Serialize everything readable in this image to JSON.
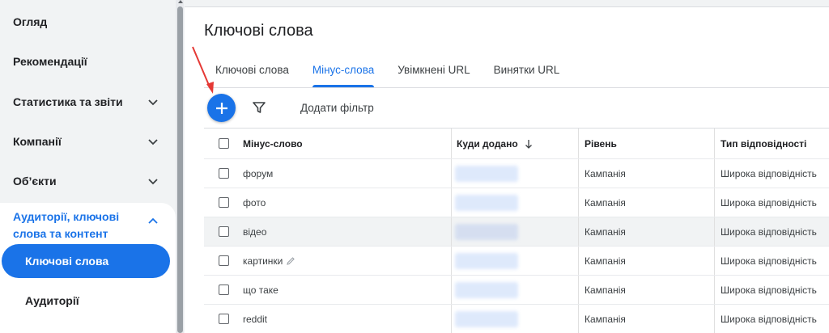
{
  "sidebar": {
    "items": [
      {
        "label": "Огляд",
        "has_chevron": false
      },
      {
        "label": "Рекомендації",
        "has_chevron": false
      },
      {
        "label": "Статистика та звіти",
        "has_chevron": true
      },
      {
        "label": "Компанії",
        "has_chevron": true
      },
      {
        "label": "Об’єкти",
        "has_chevron": true
      }
    ],
    "group": {
      "label": "Аудиторії, ключові слова та контент",
      "subitems": [
        "Ключові слова",
        "Аудиторії"
      ]
    }
  },
  "main": {
    "title": "Ключові слова",
    "tabs": [
      {
        "label": "Ключові слова",
        "active": false
      },
      {
        "label": "Мінус-слова",
        "active": true
      },
      {
        "label": "Увімкнені URL",
        "active": false
      },
      {
        "label": "Винятки URL",
        "active": false
      }
    ],
    "toolbar": {
      "add_filter_label": "Додати фільтр"
    },
    "table": {
      "headers": {
        "word": "Мінус-слово",
        "added": "Куди додано",
        "level": "Рівень",
        "match": "Тип відповідності"
      },
      "rows": [
        {
          "word": "форум",
          "level": "Кампанія",
          "match": "Широка відповідність"
        },
        {
          "word": "фото",
          "level": "Кампанія",
          "match": "Широка відповідність"
        },
        {
          "word": "відео",
          "level": "Кампанія",
          "match": "Широка відповідність"
        },
        {
          "word": "картинки",
          "level": "Кампанія",
          "match": "Широка відповідність"
        },
        {
          "word": "що таке",
          "level": "Кампанія",
          "match": "Широка відповідність"
        },
        {
          "word": "reddit",
          "level": "Кампанія",
          "match": "Широка відповідність"
        }
      ]
    }
  },
  "colors": {
    "accent": "#1a73e8",
    "annotation_arrow": "#e53935",
    "sidebar_bg": "#f1f3f4"
  },
  "icons": {
    "fab": "plus-icon",
    "filter": "filter-icon",
    "sort": "arrow-down-icon",
    "edit": "pencil-icon",
    "expand": "chevron-down-icon",
    "collapse": "chevron-up-icon"
  }
}
